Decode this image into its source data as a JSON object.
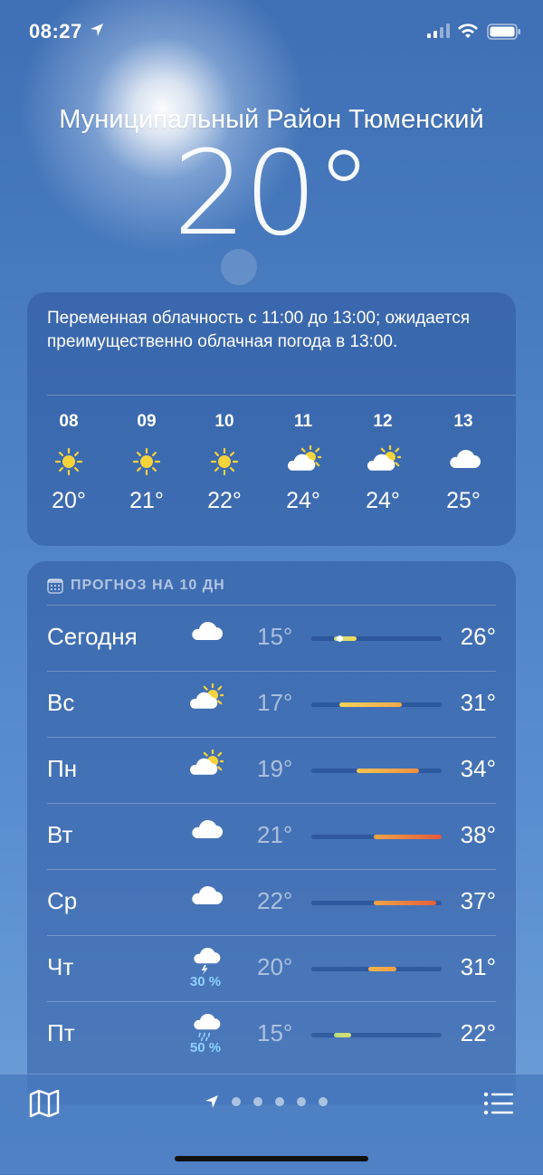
{
  "status_bar": {
    "time": "08:27"
  },
  "location": "Муниципальный Район Тюменский",
  "current_temp": "20°",
  "hourly": {
    "summary": "Переменная облачность с 11:00 до 13:00; ожидается преимущественно облачная погода в 13:00.",
    "items": [
      {
        "hour": "08",
        "icon": "sun-icon",
        "temp": "20°"
      },
      {
        "hour": "09",
        "icon": "sun-icon",
        "temp": "21°"
      },
      {
        "hour": "10",
        "icon": "sun-icon",
        "temp": "22°"
      },
      {
        "hour": "11",
        "icon": "partly-cloudy-icon",
        "temp": "24°"
      },
      {
        "hour": "12",
        "icon": "partly-cloudy-icon",
        "temp": "24°"
      },
      {
        "hour": "13",
        "icon": "cloud-icon",
        "temp": "25°"
      }
    ]
  },
  "daily": {
    "header": "ПРОГНОЗ НА 10 ДН",
    "week_range": [
      15,
      38
    ],
    "days": [
      {
        "day": "Сегодня",
        "icon": "cloud-icon",
        "pop": "",
        "low": "15°",
        "high": "26°",
        "low_val": 19,
        "high_val": 23,
        "current": 20,
        "colors": [
          "#c8e07a",
          "#f2d95a"
        ]
      },
      {
        "day": "Вс",
        "icon": "partly-cloudy-icon",
        "pop": "",
        "low": "17°",
        "high": "31°",
        "low_val": 20,
        "high_val": 31,
        "colors": [
          "#f4d35a",
          "#f1a94a"
        ]
      },
      {
        "day": "Пн",
        "icon": "partly-cloudy-icon",
        "pop": "",
        "low": "19°",
        "high": "34°",
        "low_val": 23,
        "high_val": 34,
        "colors": [
          "#f6c451",
          "#ef8f40"
        ]
      },
      {
        "day": "Вт",
        "icon": "cloud-icon",
        "pop": "",
        "low": "21°",
        "high": "38°",
        "low_val": 26,
        "high_val": 38,
        "colors": [
          "#f0a445",
          "#e5593a"
        ]
      },
      {
        "day": "Ср",
        "icon": "cloud-icon",
        "pop": "",
        "low": "22°",
        "high": "37°",
        "low_val": 26,
        "high_val": 37,
        "colors": [
          "#f0a445",
          "#e75e3b"
        ]
      },
      {
        "day": "Чт",
        "icon": "thunderstorm-icon",
        "pop": "30 %",
        "low": "20°",
        "high": "31°",
        "low_val": 25,
        "high_val": 30,
        "colors": [
          "#f3b24c",
          "#f2a045"
        ]
      },
      {
        "day": "Пт",
        "icon": "rain-icon",
        "pop": "50 %",
        "low": "15°",
        "high": "22°",
        "low_val": 19,
        "high_val": 22,
        "colors": [
          "#b8de80",
          "#d7e070"
        ]
      }
    ]
  }
}
